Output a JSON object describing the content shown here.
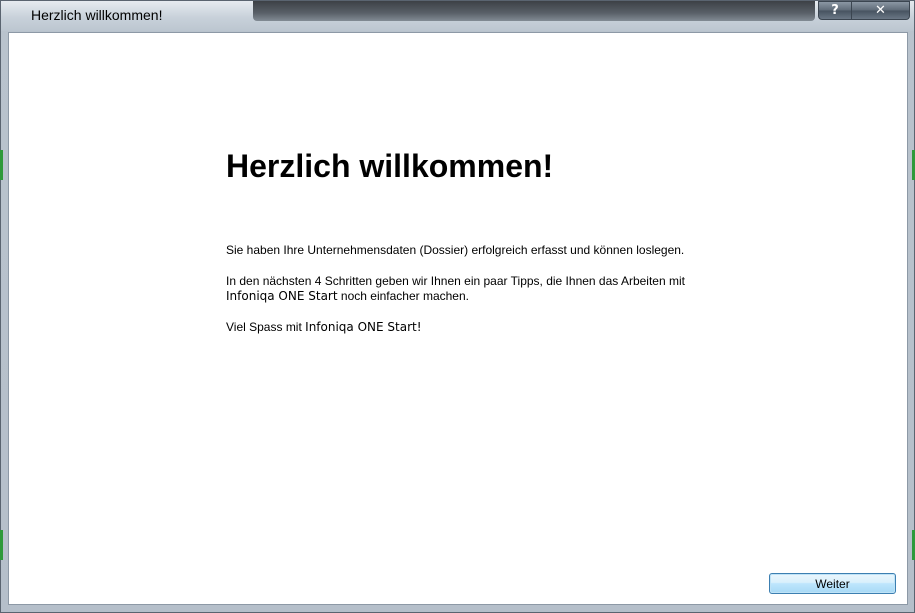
{
  "window": {
    "title": "Herzlich willkommen!",
    "help_label": "?",
    "close_label": "✕"
  },
  "content": {
    "heading": "Herzlich willkommen!",
    "paragraph1": "Sie haben Ihre Unternehmensdaten (Dossier) erfolgreich erfasst und können loslegen.",
    "paragraph2_part1": "In den nächsten 4 Schritten geben wir Ihnen ein paar Tipps, die Ihnen das Arbeiten mit",
    "paragraph2_product": "Infoniqa ONE Start",
    "paragraph2_part2": " noch einfacher machen.",
    "paragraph3_part1": "Viel Spass mit ",
    "paragraph3_product": "Infoniqa ONE Start!"
  },
  "footer": {
    "next_label": "Weiter"
  },
  "colors": {
    "client_background": "#ffffff",
    "accent_button_border": "#3c7fb1"
  }
}
